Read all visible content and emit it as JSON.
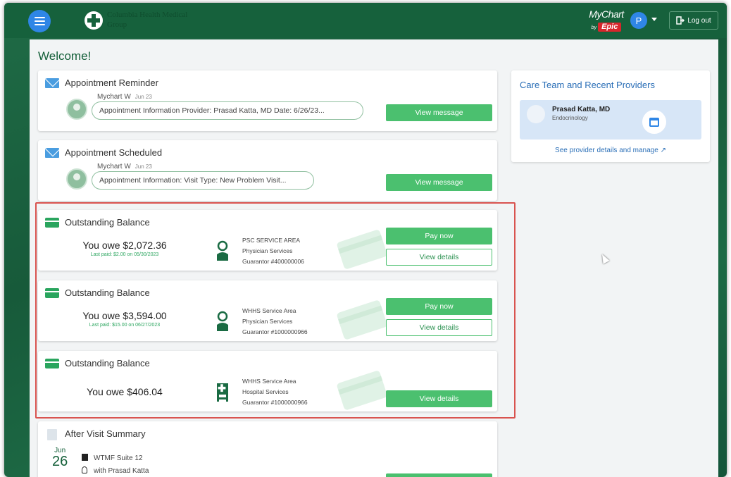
{
  "header": {
    "brand_name": "Columbia Health Medical Group",
    "mychart_label": "MyChart",
    "mychart_by": "by",
    "epic_label": "Epic",
    "avatar_initial": "P",
    "logout_label": "Log out"
  },
  "welcome": "Welcome!",
  "messages": [
    {
      "title": "Appointment Reminder",
      "sender": "Mychart W",
      "date": "Jun 23",
      "preview": "Appointment Information Provider: Prasad Katta, MD Date: 6/26/23...",
      "button": "View message"
    },
    {
      "title": "Appointment Scheduled",
      "sender": "Mychart W",
      "date": "Jun 23",
      "preview": "Appointment Information: Visit Type: New Problem Visit...",
      "button": "View message"
    }
  ],
  "balances": [
    {
      "title": "Outstanding Balance",
      "owe": "You owe $2,072.36",
      "last_paid": "Last paid: $2.00 on 05/30/2023",
      "area": "PSC SERVICE AREA",
      "service": "Physician Services",
      "guarantor": "Guarantor #400000006",
      "pay_label": "Pay now",
      "details_label": "View details"
    },
    {
      "title": "Outstanding Balance",
      "owe": "You owe $3,594.00",
      "last_paid": "Last paid: $15.00 on 06/27/2023",
      "area": "WHHS Service Area",
      "service": "Physician Services",
      "guarantor": "Guarantor #1000000966",
      "pay_label": "Pay now",
      "details_label": "View details"
    },
    {
      "title": "Outstanding Balance",
      "owe": "You owe $406.04",
      "area": "WHHS Service Area",
      "service": "Hospital Services",
      "guarantor": "Guarantor #1000000966",
      "details_label": "View details"
    }
  ],
  "after_visit": {
    "title": "After Visit Summary",
    "month": "Jun",
    "day": "26",
    "location": "WTMF Suite 12",
    "provider": "with Prasad Katta"
  },
  "care_team": {
    "title": "Care Team and Recent Providers",
    "provider_name": "Prasad Katta, MD",
    "specialty": "Endocrinology",
    "link": "See provider details and manage"
  },
  "colors": {
    "header_green": "#16613c",
    "accent_green": "#4bc06f",
    "link_blue": "#2b6fb7",
    "highlight_red": "#d9534f"
  }
}
